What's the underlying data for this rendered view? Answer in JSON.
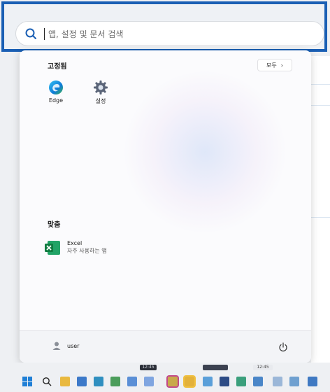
{
  "search": {
    "placeholder": "앱, 설정 및 문서 검색",
    "value": ""
  },
  "pinned": {
    "title": "고정됨",
    "all_button": "모두",
    "apps": [
      {
        "label": "Edge",
        "icon": "edge-icon"
      },
      {
        "label": "설정",
        "icon": "settings-gear-icon"
      }
    ]
  },
  "recommended": {
    "title": "맞춤",
    "items": [
      {
        "name": "Excel",
        "subtitle": "자주 사용하는 앱",
        "icon": "excel-icon"
      }
    ]
  },
  "user": {
    "name": "user"
  },
  "taskbar": {
    "clock_left": "12:45",
    "clock_right": "12:45"
  },
  "colors": {
    "accent": "#1a5fb4",
    "edge": "#0f7bd8",
    "excel": "#1d7a45"
  }
}
